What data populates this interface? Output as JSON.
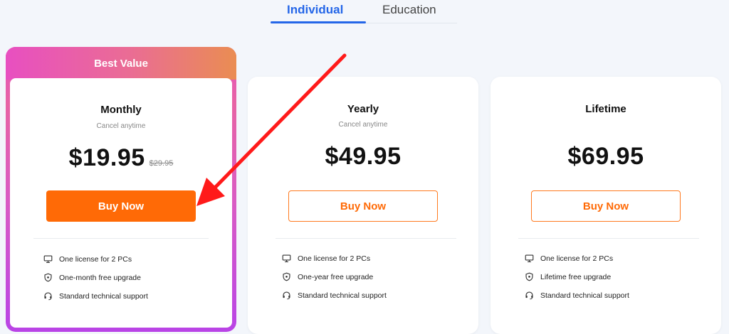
{
  "tabs": [
    {
      "label": "Individual",
      "active": true
    },
    {
      "label": "Education",
      "active": false
    }
  ],
  "featured_badge": "Best Value",
  "plans": [
    {
      "name": "Monthly",
      "subtitle": "Cancel anytime",
      "price": "$19.95",
      "old_price": "$29.95",
      "button": "Buy Now",
      "features": [
        "One license for 2 PCs",
        "One-month free upgrade",
        "Standard technical support"
      ]
    },
    {
      "name": "Yearly",
      "subtitle": "Cancel anytime",
      "price": "$49.95",
      "button": "Buy Now",
      "features": [
        "One license for 2 PCs",
        "One-year free upgrade",
        "Standard technical support"
      ]
    },
    {
      "name": "Lifetime",
      "price": "$69.95",
      "button": "Buy Now",
      "features": [
        "One license for 2 PCs",
        "Lifetime free upgrade",
        "Standard technical support"
      ]
    }
  ],
  "icons": [
    "monitor-icon",
    "shield-icon",
    "headset-icon"
  ],
  "colors": {
    "accent_blue": "#2466e8",
    "buy_orange": "#ff6a06",
    "annotation_arrow": "#ff1a1a"
  }
}
